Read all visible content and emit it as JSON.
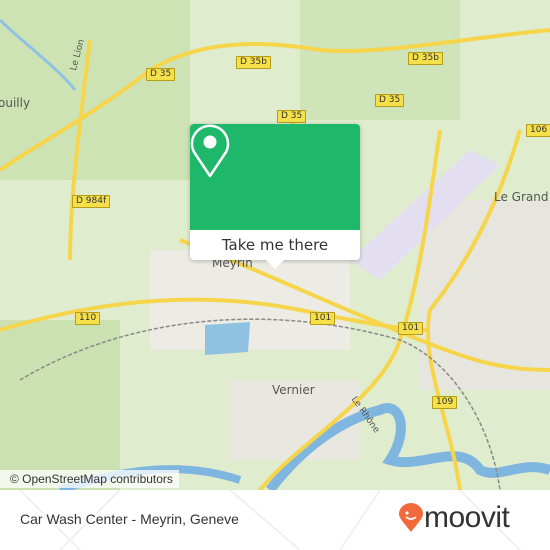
{
  "map": {
    "road_labels": [
      "D 35",
      "D 35b",
      "D 35b",
      "D 35",
      "D 35",
      "106",
      "D 984f",
      "110",
      "101",
      "101",
      "109"
    ],
    "place_labels": [
      "Meyrin",
      "Vernier",
      "Le Grand",
      "ouilly",
      "Le Rhône",
      "Le Lion"
    ],
    "attribution": "© OpenStreetMap contributors"
  },
  "popup": {
    "button_label": "Take me there",
    "icon": "location-pin-icon",
    "color": "#1fb86a"
  },
  "footer": {
    "title": "Car Wash Center - Meyrin, Geneve",
    "brand": "moovit",
    "brand_color": "#f26a3c"
  }
}
